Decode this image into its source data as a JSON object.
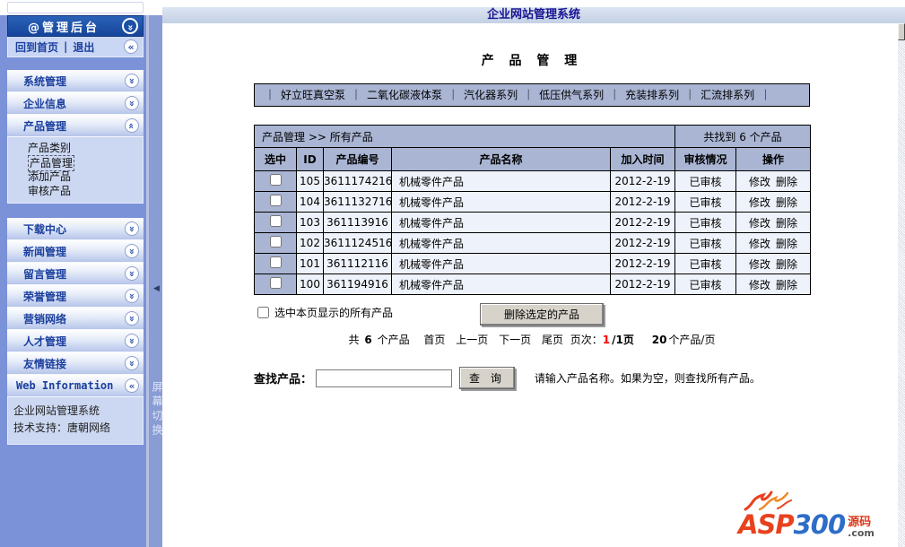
{
  "window": {
    "title": "企业网站管理系统"
  },
  "sidebar": {
    "admin_title": "@管理后台",
    "home": "回到首页",
    "divider": "|",
    "logout": "退出",
    "menu_top": [
      {
        "label": "系统管理"
      },
      {
        "label": "企业信息"
      },
      {
        "label": "产品管理"
      }
    ],
    "submenu": [
      "产品类别",
      "产品管理",
      "添加产品",
      "审核产品"
    ],
    "active_submenu": "产品管理",
    "menu_bottom": [
      {
        "label": "下载中心"
      },
      {
        "label": "新闻管理"
      },
      {
        "label": "留言管理"
      },
      {
        "label": "荣誉管理"
      },
      {
        "label": "营销网络"
      },
      {
        "label": "人才管理"
      },
      {
        "label": "友情链接"
      }
    ],
    "web_info": "Web Information",
    "footer_lines": [
      "企业网站管理系统",
      "技术支持：唐朝网络"
    ],
    "screen_toggle": "屏幕切换"
  },
  "main": {
    "page_title": "产 品 管 理",
    "cat_sep": "｜",
    "categories": [
      "好立旺真空泵",
      "二氧化碳液体泵",
      "汽化器系列",
      "低压供气系列",
      "充装排系列",
      "汇流排系列"
    ],
    "table": {
      "breadcrumb": "产品管理 >> 所有产品",
      "found": "共找到 6 个产品",
      "columns": [
        "选中",
        "ID",
        "产品编号",
        "产品名称",
        "加入时间",
        "审核情况",
        "操作"
      ],
      "rows": [
        {
          "id": "105",
          "code": "3611174216",
          "name": "机械零件产品",
          "date": "2012-2-19",
          "status": "已审核",
          "edit": "修改",
          "del": "删除"
        },
        {
          "id": "104",
          "code": "3611132716",
          "name": "机械零件产品",
          "date": "2012-2-19",
          "status": "已审核",
          "edit": "修改",
          "del": "删除"
        },
        {
          "id": "103",
          "code": "361113916",
          "name": "机械零件产品",
          "date": "2012-2-19",
          "status": "已审核",
          "edit": "修改",
          "del": "删除"
        },
        {
          "id": "102",
          "code": "3611124516",
          "name": "机械零件产品",
          "date": "2012-2-19",
          "status": "已审核",
          "edit": "修改",
          "del": "删除"
        },
        {
          "id": "101",
          "code": "361112116",
          "name": "机械零件产品",
          "date": "2012-2-19",
          "status": "已审核",
          "edit": "修改",
          "del": "删除"
        },
        {
          "id": "100",
          "code": "361194916",
          "name": "机械零件产品",
          "date": "2012-2-19",
          "status": "已审核",
          "edit": "修改",
          "del": "删除"
        }
      ]
    },
    "select_all": "选中本页显示的所有产品",
    "delete_selected": "删除选定的产品",
    "pagination": {
      "total_prefix": "共",
      "total_count": "6",
      "total_suffix": "个产品",
      "first": "首页",
      "prev": "上一页",
      "next": "下一页",
      "last": "尾页",
      "page_label": "页次：",
      "current_page": "1",
      "page_total": "/1页",
      "per_page_count": "20",
      "per_page_suffix": "个产品/页"
    },
    "search": {
      "label": "查找产品：",
      "value": "",
      "button": "查 询",
      "hint": "请输入产品名称。如果为空，则查找所有产品。"
    }
  },
  "logo": {
    "asp": "ASP",
    "num": "300",
    "cn": "源码",
    "com": ".com"
  },
  "colors": {
    "sidebar_blue": "#7b92d8",
    "panel_header_blue": "#a9b5d3",
    "row_light_blue": "#eef2fa",
    "admin_bar_blue": "#1c50a4",
    "title_navy": "#1a1492",
    "current_page_red": "#ff0000"
  }
}
